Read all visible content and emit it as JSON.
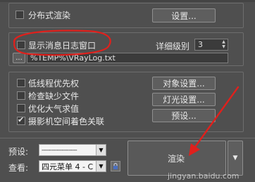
{
  "top_options": {
    "distributed_render": {
      "label": "分布式渲染",
      "checked": false
    },
    "settings_button": "设置..."
  },
  "log_options": {
    "show_log_window": {
      "label": "显示消息日志窗口",
      "checked": false
    },
    "detail_level_label": "详细级别",
    "detail_level_value": "3",
    "browse_button": "...",
    "log_path": "%TEMP%\\VRayLog.txt"
  },
  "misc_options": {
    "items": [
      {
        "label": "低线程优先权",
        "checked": false
      },
      {
        "label": "检查缺少文件",
        "checked": false
      },
      {
        "label": "优化大气求值",
        "checked": false
      },
      {
        "label": "摄影机空间着色关联",
        "checked": true
      }
    ],
    "object_settings_button": "对象设置...",
    "light_settings_button": "灯光设置...",
    "presets_button": "预设..."
  },
  "bottom": {
    "preset_label": "预设:",
    "preset_value": "---------------------",
    "view_label": "查看:",
    "view_value": "四元菜单 4 - C",
    "render_button": "渲染"
  },
  "watermark": "jingyan.baidu.com",
  "annotation_color": "#e0201c"
}
